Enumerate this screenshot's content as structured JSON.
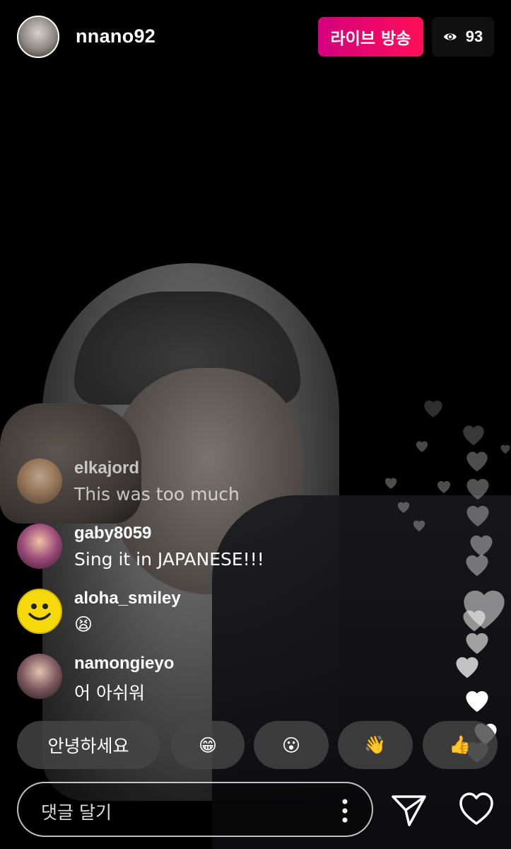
{
  "header": {
    "username": "nnano92",
    "live_label": "라이브 방송",
    "viewer_count": "93"
  },
  "comments": [
    {
      "user": "elkajord",
      "text": "This was too much"
    },
    {
      "user": "gaby8059",
      "text": "Sing it in JAPANESE!!!"
    },
    {
      "user": "aloha_smiley",
      "text": "😫"
    },
    {
      "user": "namongieyo",
      "text": "어 아쉬워"
    }
  ],
  "quick_replies": [
    {
      "label": "안녕하세요"
    },
    {
      "label": "😁"
    },
    {
      "label": "😮"
    },
    {
      "label": "👋"
    },
    {
      "label": "👍"
    }
  ],
  "composer": {
    "placeholder": "댓글 달기"
  },
  "icons": {
    "viewers": "eye-icon",
    "more": "more-options-icon",
    "send": "send-icon",
    "like": "heart-icon"
  },
  "colors": {
    "live_gradient_start": "#d3007e",
    "live_gradient_end": "#ff0f58"
  }
}
